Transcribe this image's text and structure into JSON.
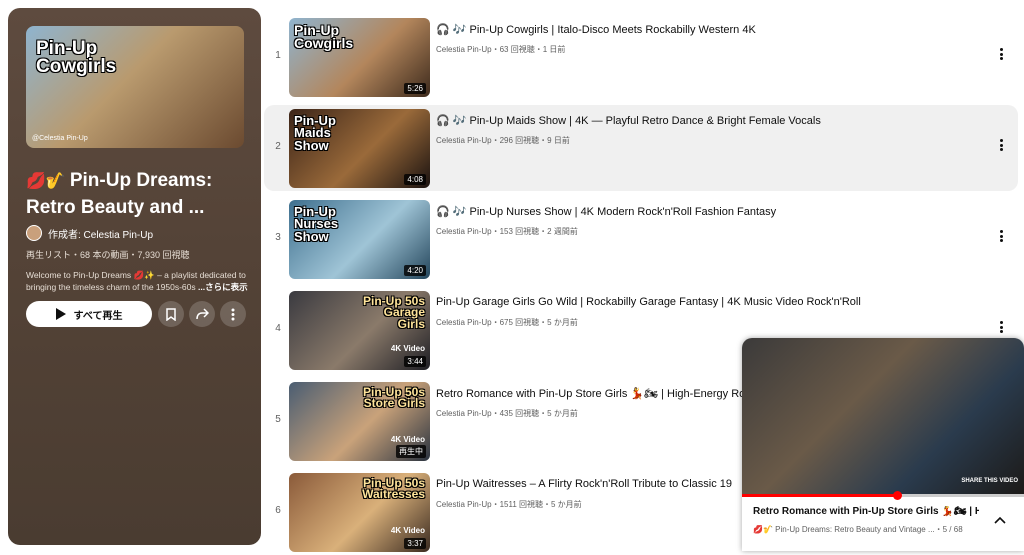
{
  "playlist": {
    "cover_text": "Pin-Up Cowgirls",
    "cover_watermark": "@Celestia Pin-Up",
    "title_line1": "Pin-Up Dreams:",
    "title_line2": "Retro Beauty and ...",
    "title_icons": "💋🎷",
    "owner": "作成者: Celestia Pin-Up",
    "meta": "再生リスト・68 本の動画・7,930 回視聴",
    "desc_line1": "Welcome to Pin-Up Dreams 💋✨ – a playlist dedicated to",
    "desc_line2": "bringing the timeless charm of the 1950s-60s",
    "desc_more": "...さらに表示",
    "play_all_label": "すべて再生"
  },
  "videos": [
    {
      "index": "1",
      "title": "🎧 🎶 Pin-Up Cowgirls | Italo-Disco Meets Rockabilly Western 4K",
      "meta": "Celestia Pin-Up・63 回視聴・1 日前",
      "duration": "5:26",
      "thumb_text": "Pin-Up Cowgirls",
      "thumb_sub": "",
      "colors": [
        "#7a5a3c",
        "#b3865c",
        "#3d2a1c"
      ]
    },
    {
      "index": "2",
      "title": "🎧 🎶 Pin-Up Maids Show | 4K — Playful Retro Dance & Bright Female Vocals",
      "meta": "Celestia Pin-Up・296 回視聴・9 日前",
      "duration": "4:08",
      "thumb_text": "Pin-Up Maids Show",
      "thumb_sub": "",
      "colors": [
        "#3b2418",
        "#9a6a3a",
        "#1a1210"
      ]
    },
    {
      "index": "3",
      "title": "🎧 🎶 Pin-Up Nurses Show | 4K Modern Rock'n'Roll Fashion Fantasy",
      "meta": "Celestia Pin-Up・153 回視聴・2 週間前",
      "duration": "4:20",
      "thumb_text": "Pin-Up Nurses Show",
      "thumb_sub": "",
      "colors": [
        "#3e6f8e",
        "#9fc4d6",
        "#24465c"
      ]
    },
    {
      "index": "4",
      "title": "Pin-Up Garage Girls Go Wild | Rockabilly Garage Fantasy | 4K Music Video Rock'n'Roll",
      "meta": "Celestia Pin-Up・675 回視聴・5 か月前",
      "duration": "3:44",
      "thumb_text": "Pin-Up 50s Garage Girls",
      "thumb_sub": "4K Video",
      "colors": [
        "#3a3a40",
        "#8a7a6a",
        "#1e1e24"
      ]
    },
    {
      "index": "5",
      "title": "Retro Romance with Pin-Up Store Girls 💃🏍 | High-Energy Ro",
      "meta": "Celestia Pin-Up・435 回視聴・5 か月前",
      "duration": "再生中",
      "thumb_text": "Pin-Up 50s Store Girls",
      "thumb_sub": "4K Video",
      "colors": [
        "#4a5d72",
        "#c9a27a",
        "#2a3340"
      ]
    },
    {
      "index": "6",
      "title": "Pin-Up Waitresses – A Flirty Rock'n'Roll Tribute to Classic 19",
      "meta": "Celestia Pin-Up・1511 回視聴・5 か月前",
      "duration": "3:37",
      "thumb_text": "Pin-Up 50s Waitresses",
      "thumb_sub": "4K Video",
      "colors": [
        "#8a5a3a",
        "#d9b07a",
        "#3a2a20"
      ]
    }
  ],
  "miniplayer": {
    "title": "Retro Romance with Pin-Up Store Girls 💃🏍 | Hi...",
    "subtitle": "💋🎷 Pin-Up Dreams: Retro Beauty and Vintage ...・5 / 68",
    "watermark": "SHARE THIS VIDEO",
    "progress": 0.55
  },
  "icons": [
    "play-icon",
    "save-icon",
    "share-icon",
    "more-icon",
    "chevron-up-icon"
  ]
}
